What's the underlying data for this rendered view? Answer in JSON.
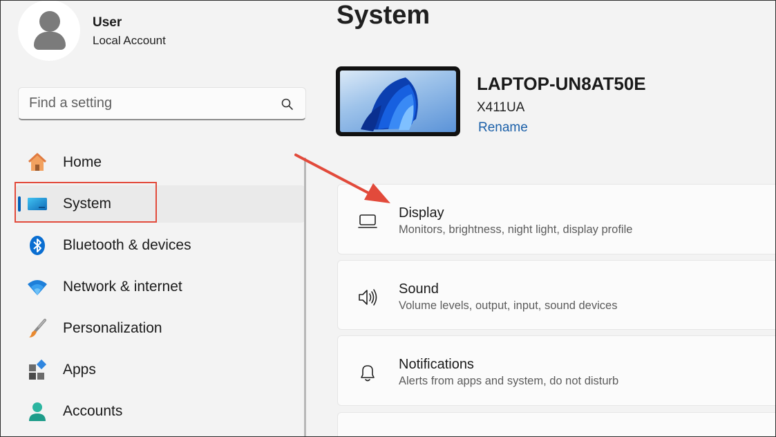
{
  "user": {
    "name": "User",
    "account_type": "Local Account"
  },
  "search": {
    "placeholder": "Find a setting"
  },
  "nav": {
    "items": [
      {
        "label": "Home",
        "icon": "home-icon"
      },
      {
        "label": "System",
        "icon": "system-icon",
        "active": true
      },
      {
        "label": "Bluetooth & devices",
        "icon": "bluetooth-icon"
      },
      {
        "label": "Network & internet",
        "icon": "wifi-icon"
      },
      {
        "label": "Personalization",
        "icon": "brush-icon"
      },
      {
        "label": "Apps",
        "icon": "apps-icon"
      },
      {
        "label": "Accounts",
        "icon": "accounts-icon"
      }
    ]
  },
  "page": {
    "title": "System"
  },
  "device": {
    "name": "LAPTOP-UN8AT50E",
    "model": "X411UA",
    "rename_label": "Rename"
  },
  "cards": [
    {
      "title": "Display",
      "description": "Monitors, brightness, night light, display profile",
      "icon": "monitor-icon"
    },
    {
      "title": "Sound",
      "description": "Volume levels, output, input, sound devices",
      "icon": "speaker-icon"
    },
    {
      "title": "Notifications",
      "description": "Alerts from apps and system, do not disturb",
      "icon": "bell-icon"
    }
  ],
  "colors": {
    "accent": "#005fb8",
    "annotation": "#e24a3b",
    "link": "#1a5fa8"
  }
}
